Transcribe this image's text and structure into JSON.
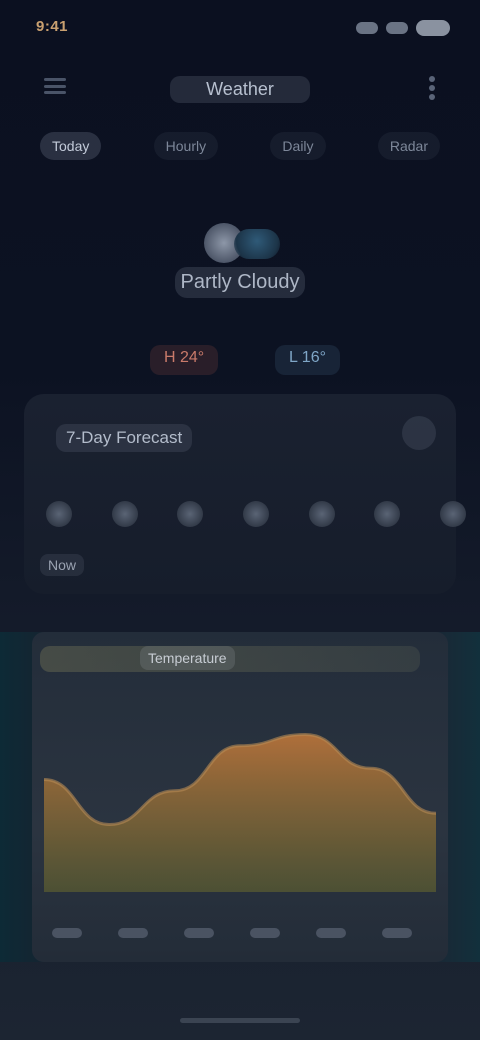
{
  "status_bar": {
    "time": "9:41",
    "accent_color": "#c9a070"
  },
  "header": {
    "title": "Weather"
  },
  "tabs": [
    {
      "label": "Today"
    },
    {
      "label": "Hourly"
    },
    {
      "label": "Daily"
    },
    {
      "label": "Radar"
    }
  ],
  "current": {
    "icon": "partly-cloudy-icon",
    "condition": "Partly Cloudy",
    "high": "H 24°",
    "low": "L 16°"
  },
  "forecast_card": {
    "title": "7-Day Forecast",
    "days": 7,
    "sub_label": "Now"
  },
  "chart_card": {
    "label": "Temperature"
  },
  "chart_data": {
    "type": "area",
    "x": [
      0,
      1,
      2,
      3,
      4,
      5,
      6
    ],
    "values": [
      20,
      12,
      18,
      26,
      28,
      22,
      14
    ],
    "ylim": [
      0,
      32
    ],
    "colors": {
      "fill_top": "#c77a3a",
      "fill_bottom": "#6a6a2e"
    }
  }
}
